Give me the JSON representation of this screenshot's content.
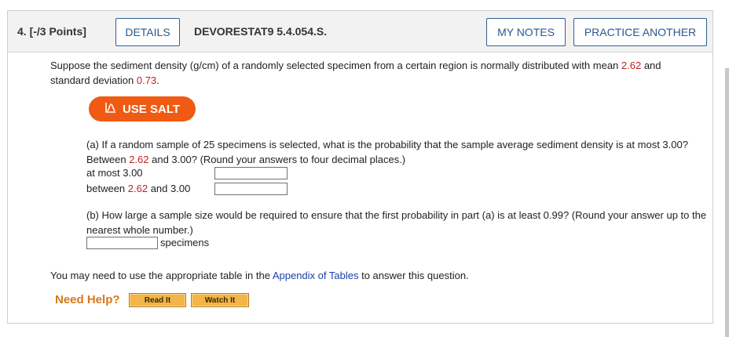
{
  "header": {
    "question_number": "4. [-/3 Points]",
    "details_label": "DETAILS",
    "assignment_code": "DEVORESTAT9 5.4.054.S.",
    "my_notes_label": "MY NOTES",
    "practice_label": "PRACTICE ANOTHER"
  },
  "intro": {
    "text_a": "Suppose the sediment density (g/cm) of a randomly selected specimen from a certain region is normally distributed with mean ",
    "mean": "2.62",
    "text_b": " and standard deviation ",
    "sd": "0.73",
    "text_c": "."
  },
  "salt_button": {
    "label": "USE SALT",
    "icon": "salt-chart-icon"
  },
  "part_a": {
    "text_a": "(a) If a random sample of 25 specimens is selected, what is the probability that the sample average sediment density is at most 3.00? Between ",
    "val1": "2.62",
    "text_b": " and 3.00? (Round your answers to four decimal places.)",
    "row1_label": "at most 3.00",
    "row2_label_a": "between ",
    "row2_val": "2.62",
    "row2_label_b": " and 3.00",
    "row1_value": "",
    "row2_value": ""
  },
  "part_b": {
    "text": "(b) How large a sample size would be required to ensure that the first probability in part (a) is at least 0.99? (Round your answer up to the nearest whole number.)",
    "unit": "specimens",
    "value": ""
  },
  "appendix": {
    "text_a": "You may need to use the appropriate table in the ",
    "link": "Appendix of Tables",
    "text_b": " to answer this question."
  },
  "help": {
    "label": "Need Help?",
    "read_it": "Read It",
    "watch_it": "Watch It"
  },
  "colors": {
    "accent": "#f05a12",
    "red_value": "#c41e1e",
    "link": "#1a3fa8",
    "help": "#d9771a"
  }
}
